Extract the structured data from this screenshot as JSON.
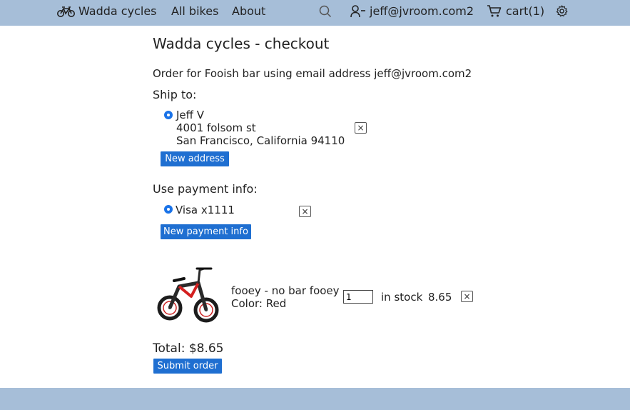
{
  "nav": {
    "brand": "Wadda cycles",
    "all_bikes": "All bikes",
    "about": "About",
    "user": "jeff@jvroom.com2",
    "cart": "cart(1)"
  },
  "page": {
    "title": "Wadda cycles - checkout",
    "order_line": "Order for Fooish bar using email address jeff@jvroom.com2",
    "ship_to_label": "Ship to:",
    "address": {
      "name": "Jeff V",
      "street": "4001 folsom st",
      "city": "San Francisco, California 94110"
    },
    "new_address_label": "New address",
    "payment_label": "Use payment info:",
    "payment_card": "Visa x1111",
    "new_payment_label": "New payment info",
    "item": {
      "name": "fooey - no bar fooey",
      "color": "Color: Red",
      "quantity": "1",
      "stock": "in stock",
      "price": "8.65"
    },
    "total": "Total: $8.65",
    "submit_label": "Submit order",
    "remove_glyph": "×"
  },
  "colors": {
    "header_bg": "#a6bed8",
    "button_bg": "#1f6fd1",
    "bike_frame": "#d42020"
  }
}
